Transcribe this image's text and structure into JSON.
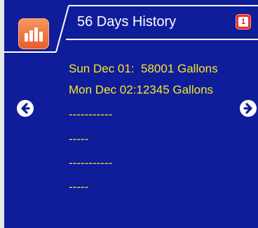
{
  "header": {
    "title": "56 Days History",
    "chart_icon": "bar-chart-icon",
    "badge_icon": "page-badge-icon",
    "badge_number": "1"
  },
  "records": [
    "Sun Dec 01:  58001 Gallons",
    "Mon Dec 02:12345 Gallons",
    "-----------",
    "-----",
    "-----------",
    "-----"
  ],
  "navigation": {
    "prev_icon": "arrow-left-circle-icon",
    "next_icon": "arrow-right-circle-icon"
  },
  "colors": {
    "background": "#0f1d9a",
    "frame_line": "#ffffff",
    "record_text": "#f5e62a",
    "title_text": "#ffffff",
    "icon_orange": "#e85c2a",
    "badge_red": "#e8342a"
  }
}
